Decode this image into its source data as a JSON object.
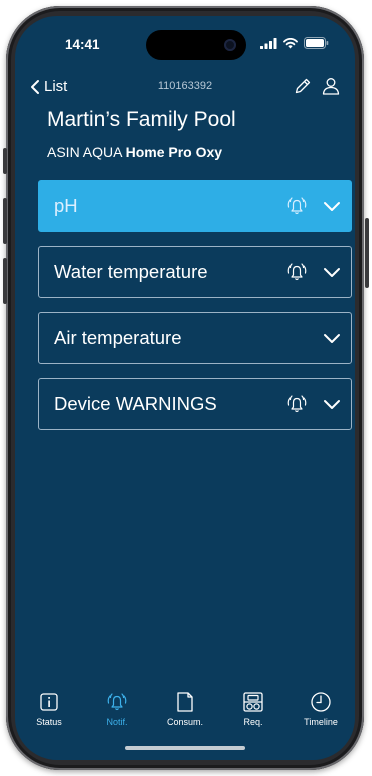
{
  "status_bar": {
    "time": "14:41"
  },
  "nav": {
    "back_label": "List",
    "device_id": "110163392"
  },
  "pool": {
    "name": "Martin’s Family Pool",
    "model_prefix": "ASIN AQUA",
    "model_name": "Home Pro Oxy"
  },
  "notification_rows": [
    {
      "label": "pH",
      "has_bell": true,
      "active": true
    },
    {
      "label": "Water temperature",
      "has_bell": true,
      "active": false
    },
    {
      "label": "Air temperature",
      "has_bell": false,
      "active": false
    },
    {
      "label": "Device WARNINGS",
      "has_bell": true,
      "active": false
    }
  ],
  "tabs": [
    {
      "label": "Status",
      "icon": "info-icon"
    },
    {
      "label": "Notif.",
      "icon": "bell-icon",
      "active": true
    },
    {
      "label": "Consum.",
      "icon": "folder-icon"
    },
    {
      "label": "Req.",
      "icon": "requirements-icon"
    },
    {
      "label": "Timeline",
      "icon": "clock-icon"
    }
  ],
  "colors": {
    "background": "#0b3b5c",
    "accent": "#2eaee6",
    "active_tab": "#3db2ec",
    "row_border": "#9cb3c6"
  }
}
